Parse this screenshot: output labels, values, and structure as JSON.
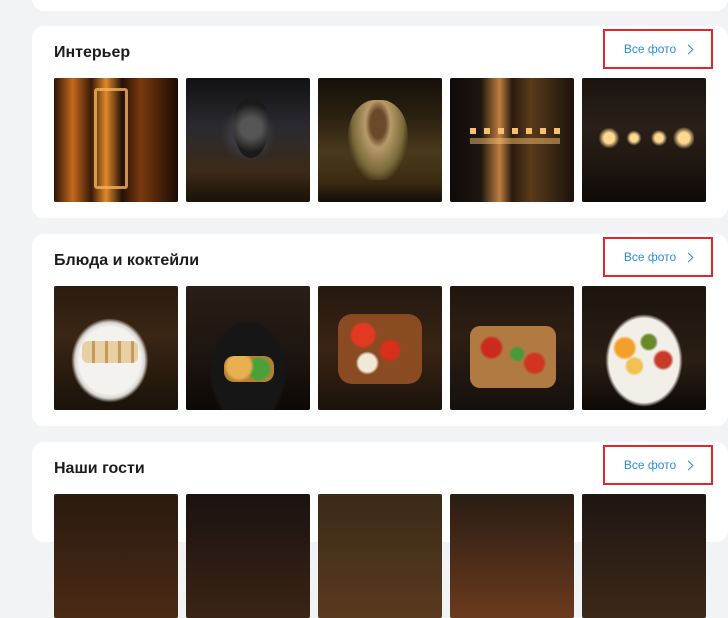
{
  "sections": [
    {
      "title": "Интерьер",
      "all_photos": "Все фото",
      "photos": [
        "interior-photo-1",
        "interior-photo-2",
        "interior-photo-3",
        "interior-photo-4",
        "interior-photo-5"
      ]
    },
    {
      "title": "Блюда и коктейли",
      "all_photos": "Все фото",
      "photos": [
        "dish-photo-1",
        "dish-photo-2",
        "dish-photo-3",
        "dish-photo-4",
        "dish-photo-5"
      ]
    },
    {
      "title": "Наши гости",
      "all_photos": "Все фото",
      "photos": [
        "guest-photo-1",
        "guest-photo-2",
        "guest-photo-3",
        "guest-photo-4",
        "guest-photo-5"
      ]
    }
  ],
  "colors": {
    "page_bg": "#f2f3f5",
    "card_bg": "#ffffff",
    "link": "#2a8ed6",
    "highlight_border": "#e0262c"
  },
  "icons": {
    "all_photos_chevron": "chevron-right-icon"
  }
}
